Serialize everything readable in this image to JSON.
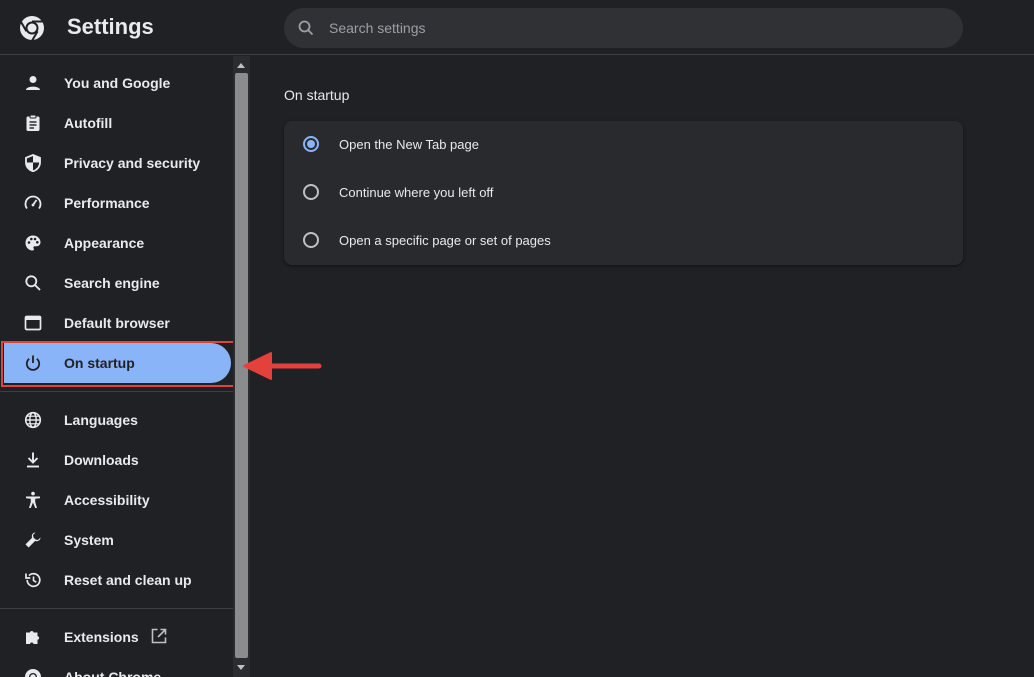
{
  "header": {
    "app_title": "Settings",
    "search_placeholder": "Search settings"
  },
  "sidebar": {
    "items": [
      {
        "label": "You and Google",
        "icon": "person-icon"
      },
      {
        "label": "Autofill",
        "icon": "clipboard-icon"
      },
      {
        "label": "Privacy and security",
        "icon": "shield-icon"
      },
      {
        "label": "Performance",
        "icon": "speedometer-icon"
      },
      {
        "label": "Appearance",
        "icon": "palette-icon"
      },
      {
        "label": "Search engine",
        "icon": "search-icon"
      },
      {
        "label": "Default browser",
        "icon": "browser-icon"
      },
      {
        "label": "On startup",
        "icon": "power-icon",
        "active": true
      },
      {
        "label": "Languages",
        "icon": "globe-icon"
      },
      {
        "label": "Downloads",
        "icon": "download-icon"
      },
      {
        "label": "Accessibility",
        "icon": "accessibility-icon"
      },
      {
        "label": "System",
        "icon": "wrench-icon"
      },
      {
        "label": "Reset and clean up",
        "icon": "reset-icon"
      },
      {
        "label": "Extensions",
        "icon": "puzzle-icon",
        "external": true
      },
      {
        "label": "About Chrome",
        "icon": "chrome-icon"
      }
    ]
  },
  "main": {
    "section_title": "On startup",
    "options": [
      {
        "label": "Open the New Tab page",
        "checked": true
      },
      {
        "label": "Continue where you left off",
        "checked": false
      },
      {
        "label": "Open a specific page or set of pages",
        "checked": false
      }
    ]
  },
  "colors": {
    "background": "#202124",
    "accent": "#8ab4f8",
    "annotation": "#e5413b"
  }
}
